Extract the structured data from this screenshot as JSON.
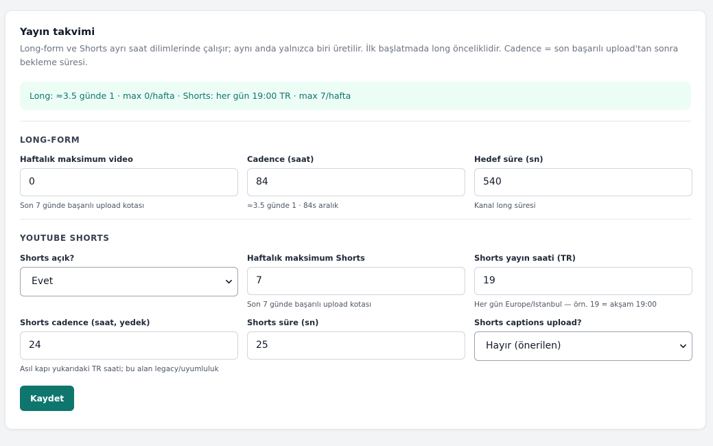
{
  "card": {
    "title": "Yayın takvimi",
    "subtitle": "Long-form ve Shorts ayrı saat dilimlerinde çalışır; aynı anda yalnızca biri üretilir. İlk başlatmada long önceliklidir. Cadence = son başarılı upload'tan sonra bekleme süresi.",
    "banner": "Long: ≈3.5 günde 1 · max 0/hafta · Shorts: her gün 19:00 TR · max 7/hafta"
  },
  "long": {
    "heading": "LONG-FORM",
    "weekly_max": {
      "label": "Haftalık maksimum video",
      "value": "0",
      "hint": "Son 7 günde başarılı upload kotası"
    },
    "cadence": {
      "label": "Cadence (saat)",
      "value": "84",
      "hint": "≈3.5 günde 1 · 84s aralık"
    },
    "target": {
      "label": "Hedef süre (sn)",
      "value": "540",
      "hint": "Kanal long süresi"
    }
  },
  "shorts": {
    "heading": "YOUTUBE SHORTS",
    "enabled": {
      "label": "Shorts açık?",
      "value": "Evet"
    },
    "weekly_max": {
      "label": "Haftalık maksimum Shorts",
      "value": "7",
      "hint": "Son 7 günde başarılı upload kotası"
    },
    "publish_hour": {
      "label": "Shorts yayın saati (TR)",
      "value": "19",
      "hint": "Her gün Europe/Istanbul — örn. 19 = akşam 19:00"
    },
    "cadence": {
      "label": "Shorts cadence (saat, yedek)",
      "value": "24",
      "hint": "Asıl kapı yukarıdaki TR saati; bu alan legacy/uyumluluk"
    },
    "duration": {
      "label": "Shorts süre (sn)",
      "value": "25"
    },
    "captions": {
      "label": "Shorts captions upload?",
      "value": "Hayır (önerilen)"
    }
  },
  "actions": {
    "save_label": "Kaydet"
  },
  "colors": {
    "accent": "#0f766e",
    "banner_bg": "#ecfdf5",
    "banner_text": "#0f766e"
  },
  "icons": {
    "select_arrow": "chevron-down-icon"
  }
}
